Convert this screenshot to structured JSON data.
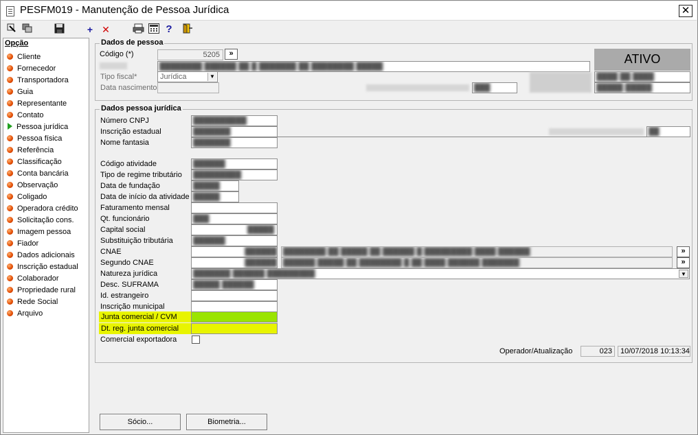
{
  "window": {
    "title": "PESFM019 - Manutenção de Pessoa Jurídica",
    "close": "✕"
  },
  "toolbar": {
    "add": "+",
    "delete": "✕",
    "help": "?"
  },
  "sidebar": {
    "title": "Opção",
    "items": [
      "Cliente",
      "Fornecedor",
      "Transportadora",
      "Guia",
      "Representante",
      "Contato",
      "Pessoa jurídica",
      "Pessoa física",
      "Referência",
      "Classificação",
      "Conta bancária",
      "Observação",
      "Coligado",
      "Operadora crédito",
      "Solicitação cons.",
      "Imagem pessoa",
      "Fiador",
      "Dados adicionais",
      "Inscrição estadual",
      "Colaborador",
      "Propriedade rural",
      "Rede Social",
      "Arquivo"
    ],
    "active": "Pessoa jurídica"
  },
  "dados_pessoa": {
    "group_title": "Dados de pessoa",
    "codigo_label": "Código (*)",
    "codigo_value": "5205",
    "codigo_btn": "»",
    "tipo_fiscal_label": "Tipo fiscal*",
    "tipo_fiscal_value": "Jurídica",
    "data_nascimento_label": "Data nascimento",
    "status": "ATIVO"
  },
  "dados_pj": {
    "group_title": "Dados pessoa jurídica",
    "labels": {
      "cnpj": "Número CNPJ",
      "ie": "Inscrição estadual",
      "fantasia": "Nome fantasia",
      "atividade": "Código atividade",
      "regime": "Tipo de regime tributário",
      "fundacao": "Data de fundação",
      "inicio": "Data de início da atividade",
      "faturamento": "Faturamento mensal",
      "qt_func": "Qt. funcionário",
      "capital": "Capital social",
      "subst": "Substituição tributária",
      "cnae": "CNAE",
      "cnae2": "Segundo CNAE",
      "natureza": "Natureza jurídica",
      "suframa": "Desc. SUFRAMA",
      "id_estr": "Id. estrangeiro",
      "insc_mun": "Inscrição municipal",
      "junta": "Junta comercial / CVM",
      "dt_junta": "Dt. reg. junta comercial",
      "exportadora": "Comercial exportadora"
    },
    "operador_label": "Operador/Atualização",
    "operador_value": "023",
    "atualizacao_value": "10/07/2018 10:13:34",
    "cnae_btn": "»"
  },
  "buttons": {
    "socio": "Sócio...",
    "biometria": "Biometria..."
  },
  "colors": {
    "highlight_yellow": "#e8f400",
    "highlight_green": "#9ae400",
    "status_bg": "#aaaaaa"
  }
}
